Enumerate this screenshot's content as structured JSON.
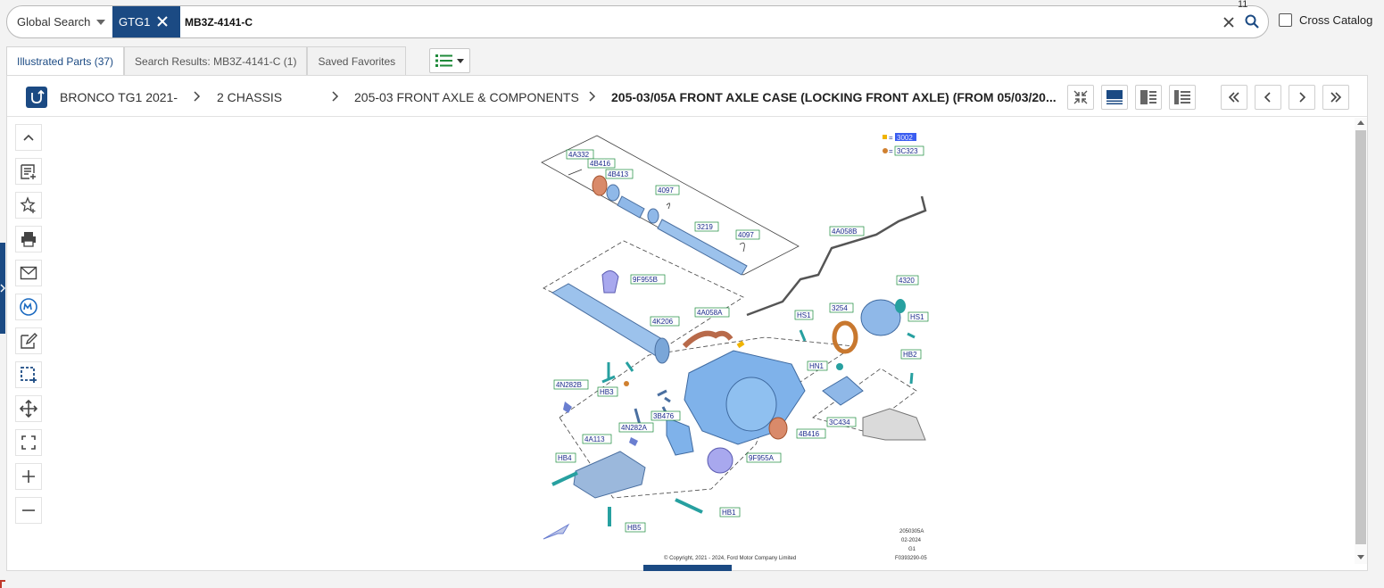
{
  "search": {
    "scope": "Global Search",
    "chip": "GTG1",
    "query": "MB3Z-4141-C",
    "result_count": "11",
    "cross_catalog_label": "Cross Catalog",
    "cross_catalog_checked": false
  },
  "tabs": [
    {
      "label": "Illustrated Parts (37)",
      "active": true
    },
    {
      "label": "Search Results: MB3Z-4141-C (1)",
      "active": false
    },
    {
      "label": "Saved Favorites",
      "active": false
    }
  ],
  "breadcrumb": {
    "items": [
      "BRONCO TG1 2021-",
      "2 CHASSIS",
      "205-03 FRONT AXLE & COMPONENTS",
      "205-03/05A FRONT AXLE CASE (LOCKING FRONT AXLE) (FROM 05/03/20..."
    ]
  },
  "left_tools": [
    "chevron-up-icon",
    "add-note-icon",
    "add-favorite-icon",
    "print-icon",
    "email-icon",
    "motorcraft-icon",
    "edit-icon",
    "select-region-icon",
    "pan-icon",
    "fit-screen-icon",
    "zoom-in-icon",
    "zoom-out-icon"
  ],
  "diagram": {
    "legend": [
      {
        "marker": "square",
        "color": "#f0b400",
        "code": "3002"
      },
      {
        "marker": "circle",
        "color": "#d08030",
        "code": "3C323"
      }
    ],
    "callouts": [
      "4A332",
      "4B416",
      "4B413",
      "4097",
      "3219",
      "4097",
      "4A058B",
      "9F955B",
      "4K206",
      "4A058A",
      "HS1",
      "3254",
      "4320",
      "HS1",
      "HB2",
      "HN1",
      "4N282B",
      "HB3",
      "3B476",
      "4N282A",
      "3C434",
      "4B416",
      "4A113",
      "9F955A",
      "HB4",
      "HB1",
      "HB5"
    ],
    "footer_code": [
      "2050305A",
      "02-2024",
      "G1",
      "F0393290-05"
    ],
    "copyright": "© Copyright, 2021 - 2024, Ford Motor Company Limited"
  },
  "colors": {
    "brand": "#1b4a83",
    "highlight": "#3a5df0",
    "part": "#8fb8e8"
  }
}
